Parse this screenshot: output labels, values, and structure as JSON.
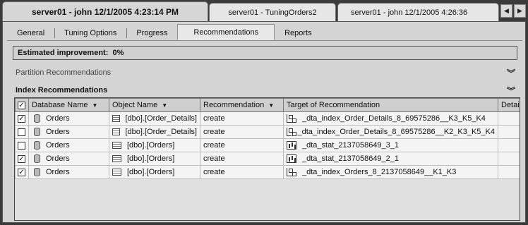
{
  "session_tabs": [
    {
      "label": "server01 - john    12/1/2005 4:23:14 PM",
      "active": true
    },
    {
      "label": "server01 - TuningOrders2",
      "active": false
    },
    {
      "label": "server01 - john      12/1/2005 4:26:36",
      "active": false
    }
  ],
  "tabs": [
    "General",
    "Tuning Options",
    "Progress",
    "Recommendations",
    "Reports"
  ],
  "active_tab": "Recommendations",
  "estimated_improvement": "Estimated improvement:  0%",
  "sections": {
    "partition": "Partition Recommendations",
    "index": "Index Recommendations"
  },
  "grid": {
    "columns": [
      "Database Name",
      "Object Name",
      "Recommendation",
      "Target of Recommendation",
      "Detai"
    ],
    "rows": [
      {
        "checked": true,
        "db": "Orders",
        "object": "[dbo].[Order_Details]",
        "rec": "create",
        "target": "_dta_index_Order_Details_8_69575286__K3_K5_K4",
        "target_icon": "index-icon"
      },
      {
        "checked": false,
        "db": "Orders",
        "object": "[dbo].[Order_Details]",
        "rec": "create",
        "target": "_dta_index_Order_Details_8_69575286__K2_K3_K5_K4",
        "target_icon": "index-icon"
      },
      {
        "checked": false,
        "db": "Orders",
        "object": "[dbo].[Orders]",
        "rec": "create",
        "target": "_dta_stat_2137058649_3_1",
        "target_icon": "statistics-icon"
      },
      {
        "checked": true,
        "db": "Orders",
        "object": "[dbo].[Orders]",
        "rec": "create",
        "target": "_dta_stat_2137058649_2_1",
        "target_icon": "statistics-icon"
      },
      {
        "checked": true,
        "db": "Orders",
        "object": "[dbo].[Orders]",
        "rec": "create",
        "target": "_dta_index_Orders_8_2137058649__K1_K3",
        "target_icon": "index-icon"
      }
    ]
  }
}
